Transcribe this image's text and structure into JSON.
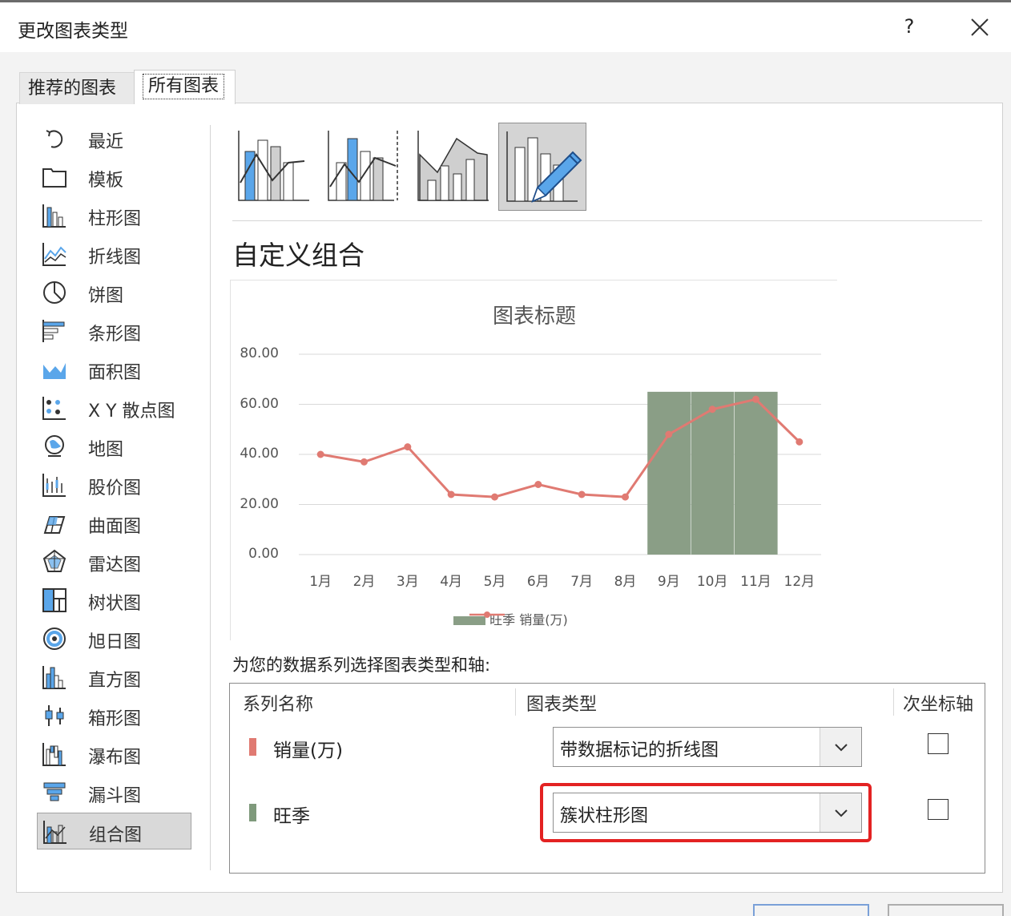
{
  "dialog": {
    "title": "更改图表类型",
    "help": "?"
  },
  "tabs": [
    {
      "label": "推荐的图表"
    },
    {
      "label": "所有图表"
    }
  ],
  "sidebar": {
    "items": [
      {
        "label": "最近",
        "icon": "recent-icon"
      },
      {
        "label": "模板",
        "icon": "template-folder-icon"
      },
      {
        "label": "柱形图",
        "icon": "column-chart-icon"
      },
      {
        "label": "折线图",
        "icon": "line-chart-icon"
      },
      {
        "label": "饼图",
        "icon": "pie-chart-icon"
      },
      {
        "label": "条形图",
        "icon": "bar-chart-icon"
      },
      {
        "label": "面积图",
        "icon": "area-chart-icon"
      },
      {
        "label": "X Y 散点图",
        "icon": "scatter-chart-icon"
      },
      {
        "label": "地图",
        "icon": "map-chart-icon"
      },
      {
        "label": "股价图",
        "icon": "stock-chart-icon"
      },
      {
        "label": "曲面图",
        "icon": "surface-chart-icon"
      },
      {
        "label": "雷达图",
        "icon": "radar-chart-icon"
      },
      {
        "label": "树状图",
        "icon": "treemap-chart-icon"
      },
      {
        "label": "旭日图",
        "icon": "sunburst-chart-icon"
      },
      {
        "label": "直方图",
        "icon": "histogram-chart-icon"
      },
      {
        "label": "箱形图",
        "icon": "box-whisker-chart-icon"
      },
      {
        "label": "瀑布图",
        "icon": "waterfall-chart-icon"
      },
      {
        "label": "漏斗图",
        "icon": "funnel-chart-icon"
      },
      {
        "label": "组合图",
        "icon": "combo-chart-icon"
      }
    ],
    "selected": "组合图"
  },
  "combo": {
    "heading": "自定义组合",
    "instruction": "为您的数据系列选择图表类型和轴:"
  },
  "chart_data": {
    "type": "bar",
    "title": "图表标题",
    "categories": [
      "1月",
      "2月",
      "3月",
      "4月",
      "5月",
      "6月",
      "7月",
      "8月",
      "9月",
      "10月",
      "11月",
      "12月"
    ],
    "y_ticks": [
      "80.00",
      "60.00",
      "40.00",
      "20.00",
      "0.00"
    ],
    "ylim": [
      0,
      80
    ],
    "grid": true,
    "legend_position": "bottom",
    "series": [
      {
        "name": "旺季",
        "type": "bar",
        "color": "#8a9e86",
        "values": [
          0,
          0,
          0,
          0,
          0,
          0,
          0,
          0,
          65,
          65,
          65,
          0
        ]
      },
      {
        "name": "销量(万)",
        "type": "line-markers",
        "color": "#e07a72",
        "values": [
          40,
          37,
          43,
          24,
          23,
          28,
          24,
          23,
          48,
          58,
          62,
          45
        ]
      }
    ]
  },
  "series_table": {
    "headers": {
      "name": "系列名称",
      "type": "图表类型",
      "axis": "次坐标轴"
    },
    "rows": [
      {
        "name": "销量(万)",
        "color": "#e07a72",
        "chart_type": "带数据标记的折线图",
        "secondary_axis": false
      },
      {
        "name": "旺季",
        "color": "#7f9a7c",
        "chart_type": "簇状柱形图",
        "secondary_axis": false
      }
    ]
  },
  "colors": {
    "highlight": "#e32222",
    "accent_blue": "#5aa6ea"
  }
}
